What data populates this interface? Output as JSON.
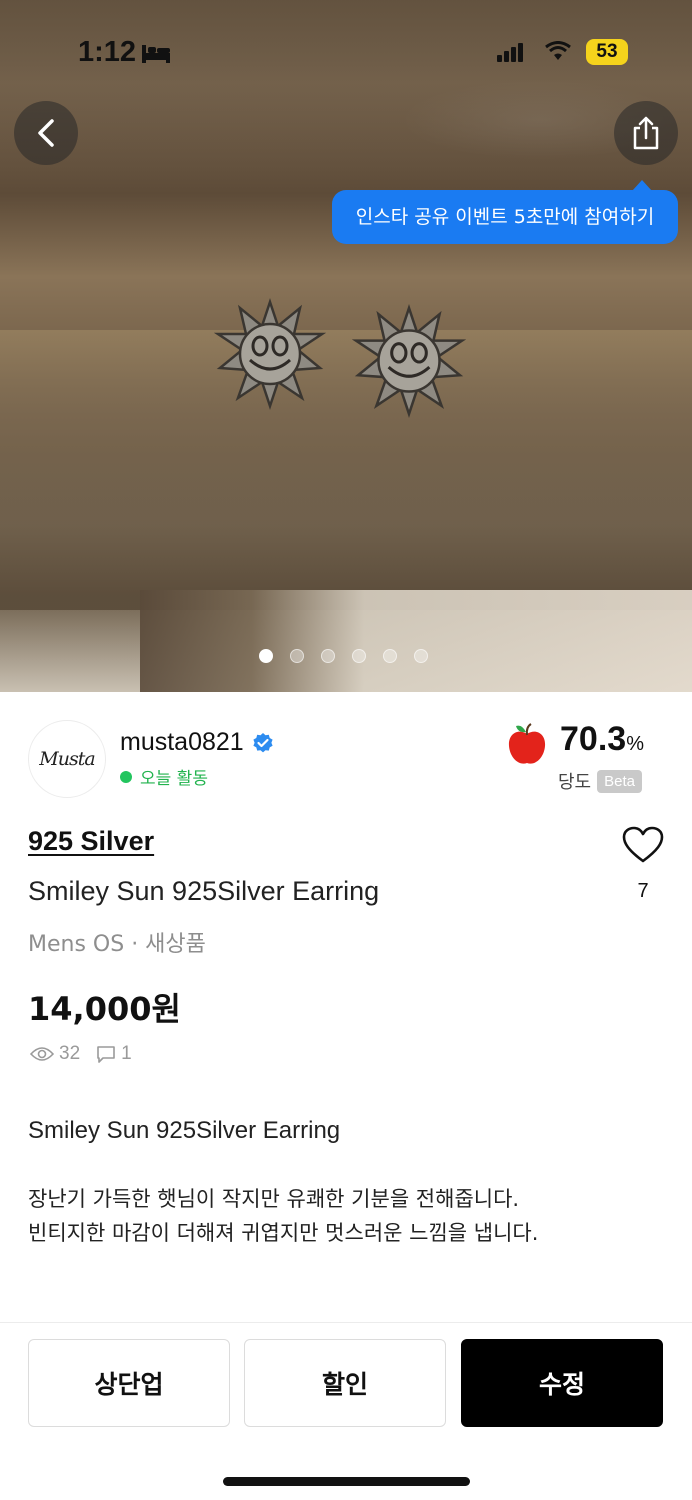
{
  "status_bar": {
    "time": "1:12",
    "battery": "53",
    "battery_color": "#f5d31c"
  },
  "hero": {
    "tooltip": "인스타 공유 이벤트 5초만에 참여하기",
    "tooltip_color": "#1a7bf2",
    "image_count": 6,
    "active_index": 0
  },
  "seller": {
    "avatar_text": "Musta",
    "name": "musta0821",
    "activity": "오늘 활동",
    "activity_color": "#22b34e"
  },
  "sweetness": {
    "value": "70.3",
    "unit": "%",
    "label": "당도",
    "badge": "Beta"
  },
  "product": {
    "brand": "925 Silver",
    "title": "Smiley Sun 925Silver Earring",
    "meta": "Mens OS · 새상품",
    "price": "14,000원",
    "views": "32",
    "comments": "1",
    "likes": "7"
  },
  "description": {
    "line1": "Smiley Sun 925Silver Earring",
    "line2": "장난기 가득한 햇님이 작지만 유쾌한 기분을 전해줍니다.",
    "line3": "빈티지한 마감이 더해져 귀엽지만 멋스러운 느낌을 냅니다."
  },
  "actions": {
    "bump": "상단업",
    "discount": "할인",
    "edit": "수정"
  },
  "icons": [
    "bed-icon",
    "signal-icon",
    "wifi-icon",
    "back-arrow-icon",
    "share-icon",
    "verified-icon",
    "apple-icon",
    "heart-icon",
    "eye-icon",
    "comment-icon"
  ]
}
